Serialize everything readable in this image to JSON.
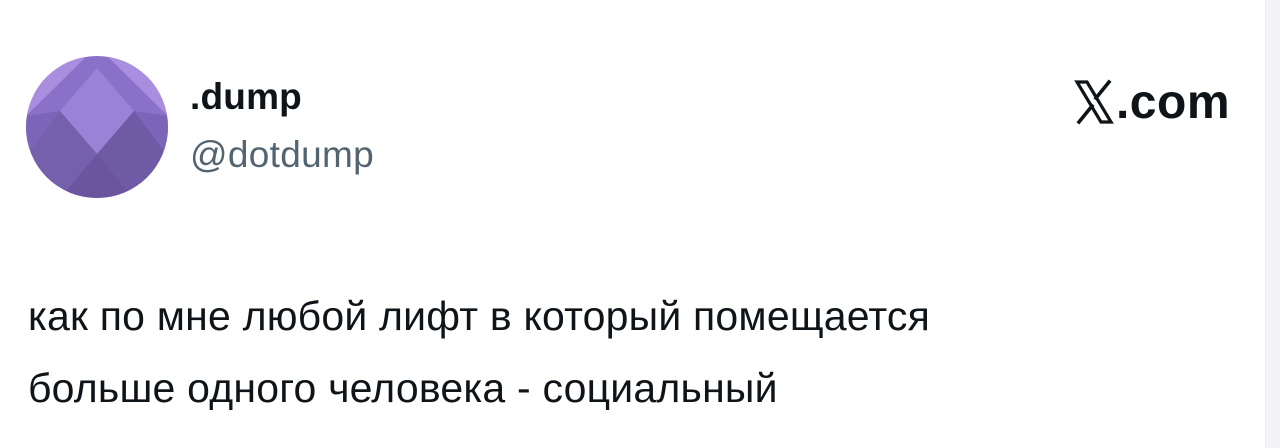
{
  "tweet": {
    "author": {
      "display_name": ".dump",
      "handle": "@dotdump",
      "avatar_icon": "purple-diamond-avatar"
    },
    "brand": {
      "icon": "x-logo-icon",
      "label": ".com"
    },
    "text_lines": [
      "как по мне любой лифт в который помещается",
      "больше одного человека - социальный"
    ]
  },
  "colors": {
    "avatar_light": "#a98ee0",
    "avatar_mid": "#8a70c8",
    "avatar_dark": "#6a559e",
    "text_primary": "#0f1419",
    "text_secondary": "#536471"
  }
}
